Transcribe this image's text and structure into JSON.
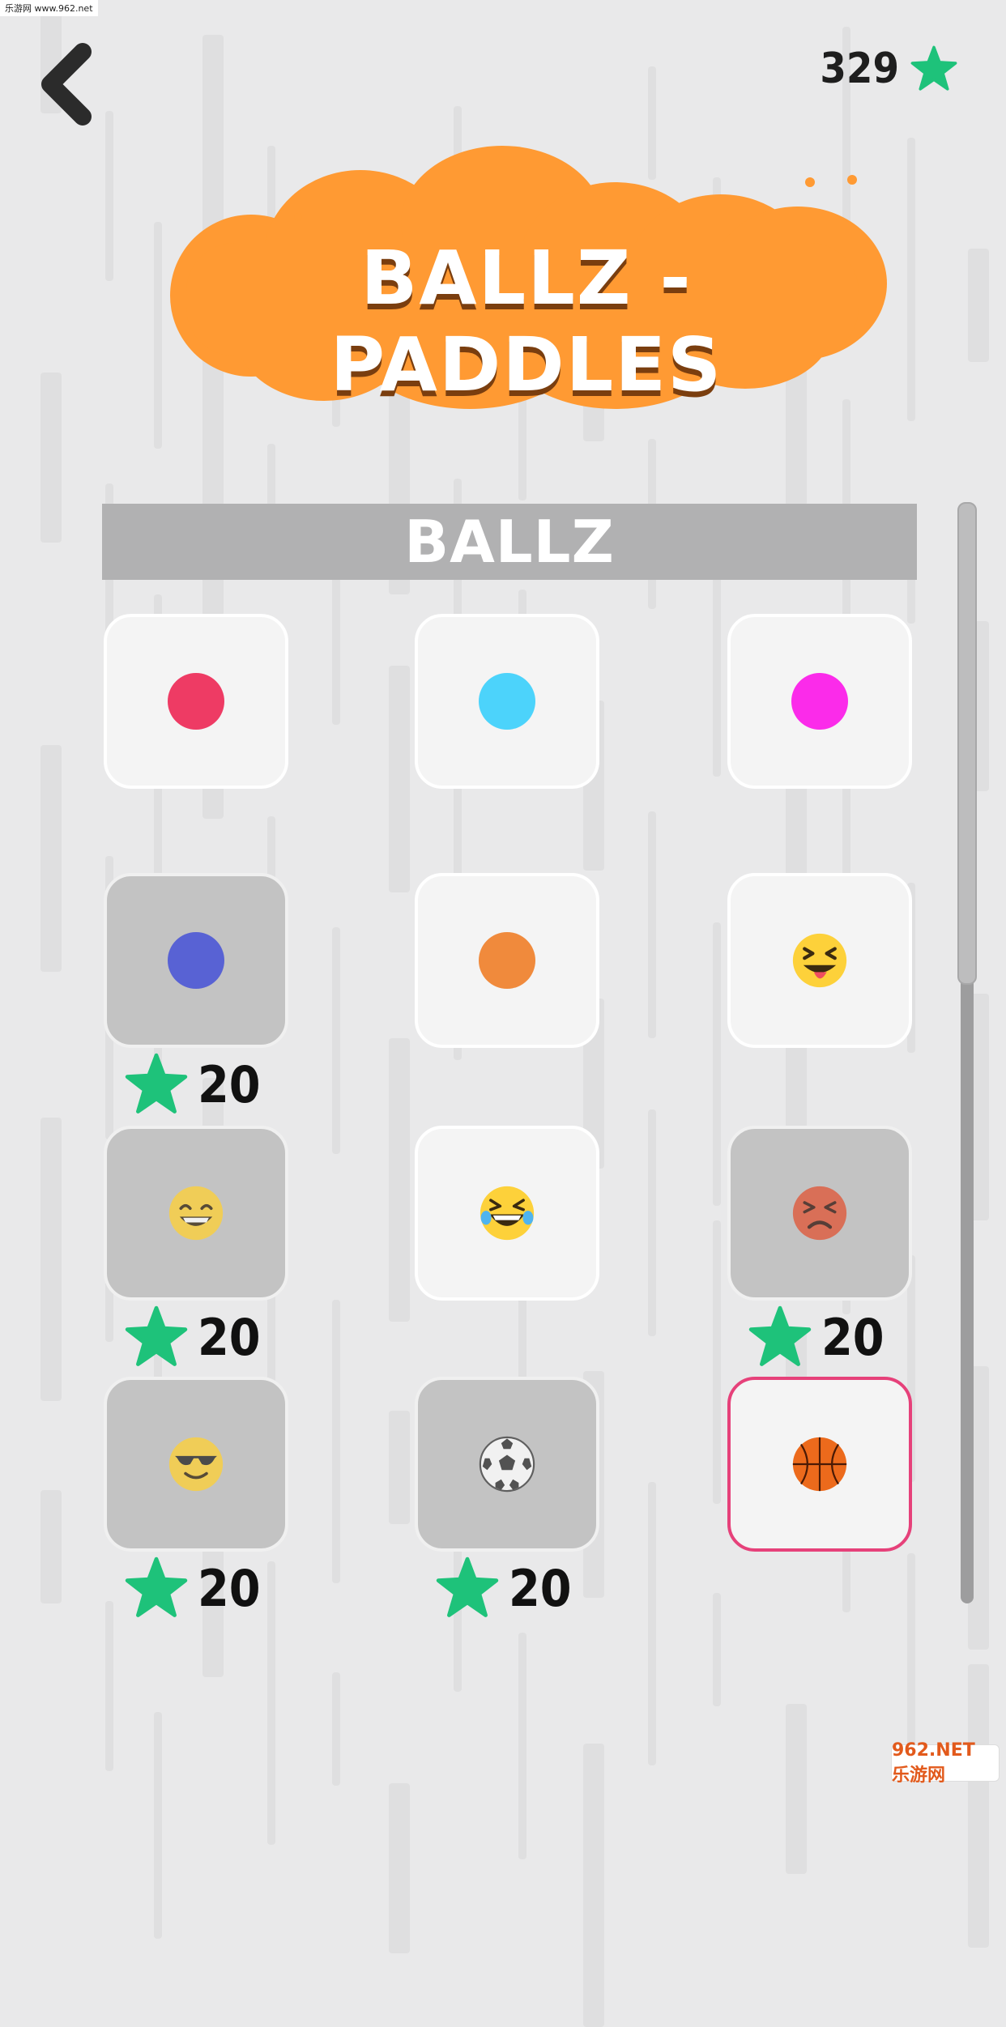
{
  "watermark": "乐游网 www.962.net",
  "header": {
    "back_icon": "chevron-left-icon",
    "star_total": "329",
    "star_icon": "star-icon"
  },
  "title": "BALLZ - PADDLES",
  "section": "BALLZ",
  "colors": {
    "accent_orange": "#ff9a33",
    "star_green": "#1ec27a",
    "selected_border": "#e6417a"
  },
  "items": [
    {
      "kind": "ball",
      "color": "#ee3b64",
      "locked": false,
      "price": ""
    },
    {
      "kind": "ball",
      "color": "#4cd3fb",
      "locked": false,
      "price": ""
    },
    {
      "kind": "ball",
      "color": "#fb2bea",
      "locked": false,
      "price": ""
    },
    {
      "kind": "ball",
      "color": "#3a46d8",
      "locked": true,
      "price": "20"
    },
    {
      "kind": "ball",
      "color": "#f08a3c",
      "locked": false,
      "price": ""
    },
    {
      "kind": "emoji",
      "icon": "tongue-out-emoji-icon",
      "locked": false,
      "price": ""
    },
    {
      "kind": "emoji",
      "icon": "smile-emoji-icon",
      "locked": true,
      "price": "20"
    },
    {
      "kind": "emoji",
      "icon": "laughing-tears-emoji-icon",
      "locked": false,
      "price": ""
    },
    {
      "kind": "emoji",
      "icon": "angry-emoji-icon",
      "locked": true,
      "price": "20"
    },
    {
      "kind": "emoji",
      "icon": "sunglasses-emoji-icon",
      "locked": true,
      "price": "20"
    },
    {
      "kind": "emoji",
      "icon": "soccer-ball-icon",
      "locked": true,
      "price": "20"
    },
    {
      "kind": "emoji",
      "icon": "basketball-icon",
      "locked": false,
      "selected": true,
      "price": ""
    }
  ],
  "footer_badge": "962.NET 乐游网"
}
